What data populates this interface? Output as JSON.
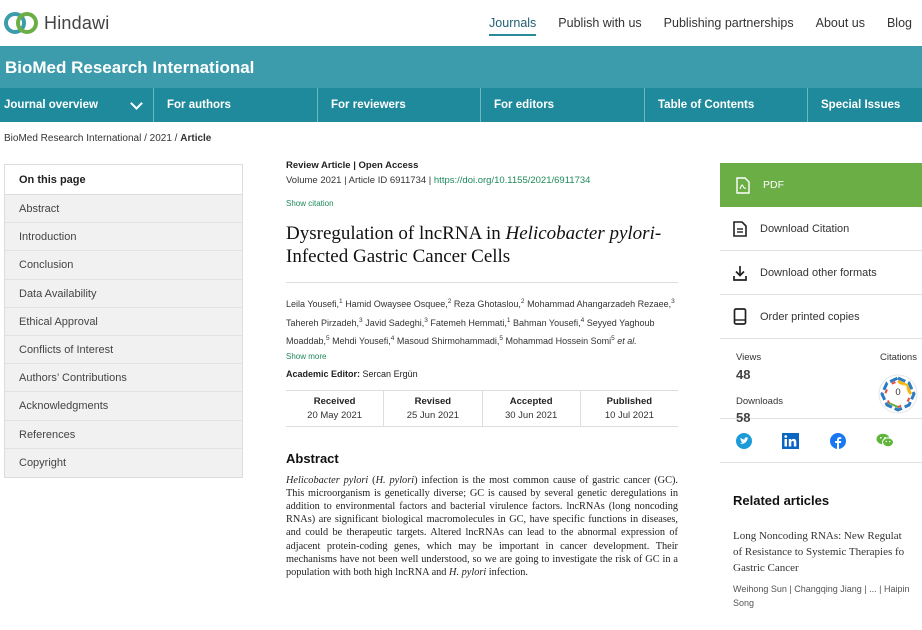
{
  "header": {
    "logo_text": "Hindawi",
    "nav": [
      "Journals",
      "Publish with us",
      "Publishing partnerships",
      "About us",
      "Blog"
    ],
    "active_nav": "Journals",
    "journal_title": "BioMed Research International",
    "subnav": [
      "Journal overview",
      "For authors",
      "For reviewers",
      "For editors",
      "Table of Contents",
      "Special Issues"
    ]
  },
  "breadcrumb": {
    "journal": "BioMed Research International",
    "sep1": " / ",
    "year": "2021",
    "sep2": " / ",
    "current": "Article"
  },
  "toc": {
    "heading": "On this page",
    "items": [
      "Abstract",
      "Introduction",
      "Conclusion",
      "Data Availability",
      "Ethical Approval",
      "Conflicts of Interest",
      "Authors’ Contributions",
      "Acknowledgments",
      "References",
      "Copyright"
    ]
  },
  "article": {
    "type_line": "Review Article | Open Access",
    "volume_line": "Volume 2021 | Article ID 6911734 | ",
    "doi": "https://doi.org/10.1155/2021/6911734",
    "show_citation": "Show citation",
    "title_part1": "Dysregulation of lncRNA in ",
    "title_italic": "Helicobacter pylori",
    "title_part2": "-Infected Gastric Cancer Cells",
    "authors": [
      {
        "name": "Leila Yousefi,",
        "sup": "1"
      },
      {
        "name": "Hamid Owaysee Osquee,",
        "sup": "2"
      },
      {
        "name": "Reza Ghotaslou,",
        "sup": "2"
      },
      {
        "name": "Mohammad Ahangarzadeh Rezaee,",
        "sup": "3"
      },
      {
        "name": "Tahereh Pirzadeh,",
        "sup": "3"
      },
      {
        "name": "Javid Sadeghi,",
        "sup": "3"
      },
      {
        "name": "Fatemeh Hemmati,",
        "sup": "1"
      },
      {
        "name": "Bahman Yousefi,",
        "sup": "4"
      },
      {
        "name": "Seyyed Yaghoub Moaddab,",
        "sup": "5"
      },
      {
        "name": "Mehdi Yousefi,",
        "sup": "4"
      },
      {
        "name": "Masoud Shirmohammadi,",
        "sup": "5"
      },
      {
        "name": "Mohammad Hossein Somi",
        "sup": "5"
      }
    ],
    "et_al": "et al.",
    "show_more": "Show more",
    "editor_label": "Academic Editor:",
    "editor_name": "Sercan Ergün",
    "dates": [
      {
        "label": "Received",
        "value": "20 May 2021"
      },
      {
        "label": "Revised",
        "value": "25 Jun 2021"
      },
      {
        "label": "Accepted",
        "value": "30 Jun 2021"
      },
      {
        "label": "Published",
        "value": "10 Jul 2021"
      }
    ],
    "abstract_heading": "Abstract",
    "abstract_italic1": "Helicobacter pylori",
    "abstract_open": " (",
    "abstract_italic2": "H. pylori",
    "abstract_body": ") infection is the most common cause of gastric cancer (GC). This microorganism is genetically diverse; GC is caused by several genetic deregulations in addition to environmental factors and bacterial virulence factors. lncRNAs (long noncoding RNAs) are significant biological macromolecules in GC, have specific functions in diseases, and could be therapeutic targets. Altered lncRNAs can lead to the abnormal expression of adjacent protein-coding genes, which may be important in cancer development. Their mechanisms have not been well understood, so we are going to investigate the risk of GC in a population with both high lncRNA and ",
    "abstract_italic3": "H. pylori",
    "abstract_end": " infection."
  },
  "sidebar_right": {
    "pdf": "PDF",
    "download_citation": "Download Citation",
    "download_formats": "Download other formats",
    "order_copies": "Order printed copies",
    "views_label": "Views",
    "views": "48",
    "downloads_label": "Downloads",
    "downloads": "58",
    "citations_label": "Citations",
    "citations": "0",
    "share_icons": [
      "twitter-icon",
      "linkedin-icon",
      "facebook-icon",
      "wechat-icon"
    ],
    "related_heading": "Related articles",
    "related_title_lines": [
      "Long Noncoding RNAs: New Regulat",
      "of Resistance to Systemic Therapies fo",
      "Gastric Cancer"
    ],
    "related_author_lines": [
      "Weihong Sun | Changqing Jiang | ... | Haipin",
      "Song"
    ]
  },
  "colors": {
    "journal_band": "#3c9cab",
    "subnav": "#1f8a9b",
    "pdf_green": "#6cae46",
    "link_green": "#1f8a5b"
  }
}
